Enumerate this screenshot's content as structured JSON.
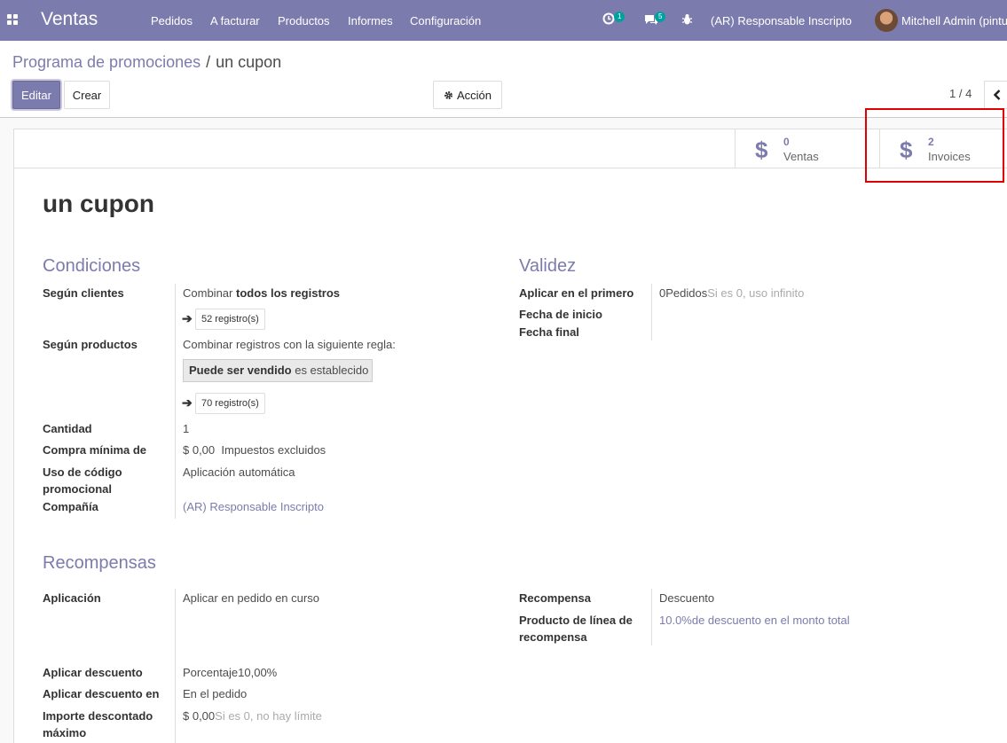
{
  "navbar": {
    "app_name": "Ventas",
    "menu": [
      "Pedidos",
      "A facturar",
      "Productos",
      "Informes",
      "Configuración"
    ],
    "activity_badge": "1",
    "messages_badge": "5",
    "company": "(AR) Responsable Inscripto",
    "user": "Mitchell Admin (pintu"
  },
  "breadcrumb": {
    "parent": "Programa de promociones",
    "separator": "/",
    "current": "un cupon"
  },
  "toolbar": {
    "edit_label": "Editar",
    "create_label": "Crear",
    "action_label": "Acción",
    "pager": "1 / 4"
  },
  "stat_buttons": [
    {
      "value": "0",
      "label": "Ventas"
    },
    {
      "value": "2",
      "label": "Invoices"
    }
  ],
  "record": {
    "title": "un cupon"
  },
  "condiciones": {
    "title": "Condiciones",
    "segun_clientes_label": "Según clientes",
    "segun_clientes_prefix": "Combinar",
    "segun_clientes_bold": "todos los registros",
    "clientes_records": "52 registro(s)",
    "segun_productos_label": "Según productos",
    "segun_productos_text": "Combinar registros con la siguiente regla:",
    "rule_field": "Puede ser vendido",
    "rule_op": "es establecido",
    "productos_records": "70 registro(s)",
    "cantidad_label": "Cantidad",
    "cantidad_value": "1",
    "compra_minima_label": "Compra mínima de",
    "compra_minima_value": "$ 0,00",
    "compra_minima_tax": "Impuestos excluidos",
    "uso_codigo_label_1": "Uso de código",
    "uso_codigo_label_2": "promocional",
    "uso_codigo_value": "Aplicación automática",
    "compania_label": "Compañía",
    "compania_value": "(AR) Responsable Inscripto"
  },
  "validez": {
    "title": "Validez",
    "aplicar_label": "Aplicar en el primero",
    "aplicar_value": "0",
    "aplicar_unit": "Pedidos",
    "aplicar_hint": "Si es 0, uso infinito",
    "fecha_inicio_label": "Fecha de inicio",
    "fecha_final_label": "Fecha final"
  },
  "recompensas": {
    "title": "Recompensas",
    "aplicacion_label": "Aplicación",
    "aplicacion_value": "Aplicar en pedido en curso",
    "recompensa_label": "Recompensa",
    "recompensa_value": "Descuento",
    "producto_linea_label_1": "Producto de línea de",
    "producto_linea_label_2": "recompensa",
    "producto_linea_value": "10.0%de descuento en el monto total",
    "aplicar_descuento_label": "Aplicar descuento",
    "aplicar_descuento_value": "Porcentaje10,00%",
    "aplicar_descuento_en_label": "Aplicar descuento en",
    "aplicar_descuento_en_value": "En el pedido",
    "importe_label_1": "Importe descontado",
    "importe_label_2": "máximo",
    "importe_value": "$ 0,00",
    "importe_hint": "Si es 0, no hay límite"
  },
  "colors": {
    "brand": "#7c7bad",
    "highlight": "#e00000",
    "badge": "#00a09d"
  }
}
